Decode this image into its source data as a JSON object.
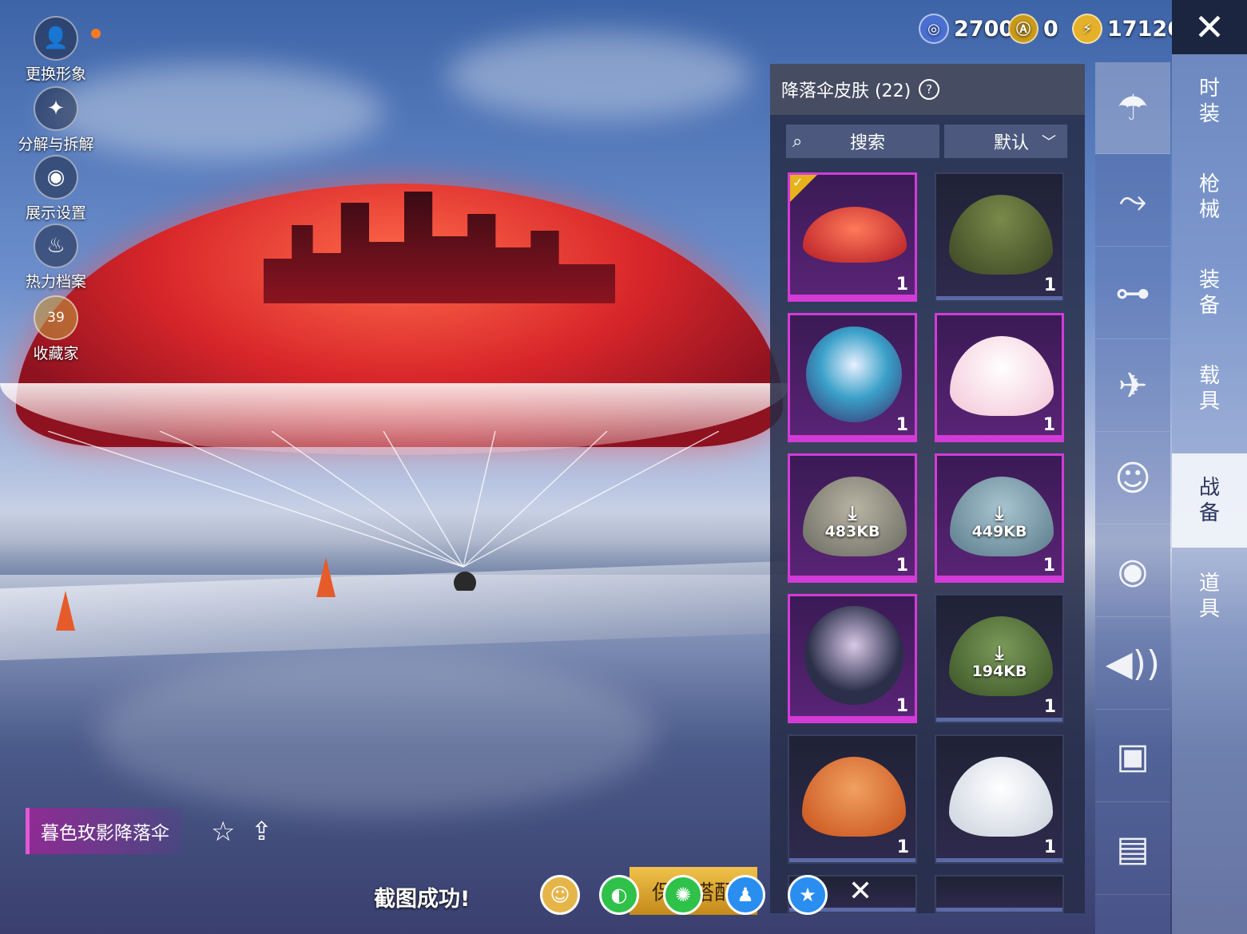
{
  "left_menu": [
    {
      "label": "更换形象",
      "icon": "avatar-icon"
    },
    {
      "label": "分解与拆解",
      "icon": "puzzle-icon"
    },
    {
      "label": "展示设置",
      "icon": "eye-icon"
    },
    {
      "label": "热力档案",
      "icon": "flame-icon"
    },
    {
      "label": "收藏家",
      "icon": "collector-badge-icon",
      "badge": "39"
    }
  ],
  "currencies": [
    {
      "value": "2700",
      "icon": "uc-coin-icon",
      "color": "#4a6fd0"
    },
    {
      "value": "0",
      "icon": "gold-ag-icon",
      "color": "#c99a1a"
    },
    {
      "value": "17126",
      "icon": "bp-lightning-icon",
      "color": "#e6b12a"
    }
  ],
  "close_glyph": "✕",
  "right_tabs": [
    {
      "label": [
        "时",
        "装"
      ]
    },
    {
      "label": [
        "枪",
        "械"
      ]
    },
    {
      "label": [
        "装",
        "备"
      ]
    },
    {
      "label": [
        "载",
        "具"
      ]
    },
    {
      "label": [
        "战",
        "备"
      ],
      "active": true
    },
    {
      "label": [
        "道",
        "具"
      ]
    }
  ],
  "icon_column": [
    {
      "icon": "parachute-icon",
      "glyph": "☂",
      "active": true
    },
    {
      "icon": "skydiving-icon",
      "glyph": "🪂"
    },
    {
      "icon": "drone-icon",
      "glyph": "✈"
    },
    {
      "icon": "airplane-icon",
      "glyph": "✈"
    },
    {
      "icon": "emote-icon",
      "glyph": "☺"
    },
    {
      "icon": "companion-icon",
      "glyph": "◉"
    },
    {
      "icon": "sound-icon",
      "glyph": "🔊"
    },
    {
      "icon": "chat-bubble-icon",
      "glyph": "▣"
    },
    {
      "icon": "gallery-icon",
      "glyph": "▤"
    }
  ],
  "panel": {
    "title": "降落伞皮肤 (22)",
    "help": "?",
    "search_placeholder": "搜索",
    "sort_label": "默认",
    "sort_chevron": "﹀"
  },
  "items": [
    {
      "count": "1",
      "rarity": "epic",
      "equipped": true,
      "color": "#d8262a"
    },
    {
      "count": "1",
      "rarity": "blue",
      "color": "#5a6a3a"
    },
    {
      "count": "1",
      "rarity": "epic",
      "color": "#3aa0c8"
    },
    {
      "count": "1",
      "rarity": "epic",
      "color": "#f3c4d6"
    },
    {
      "count": "1",
      "rarity": "epic",
      "download": "483KB",
      "color": "#8a8a84"
    },
    {
      "count": "1",
      "rarity": "epic",
      "download": "449KB",
      "color": "#7ea2b4"
    },
    {
      "count": "1",
      "rarity": "epic",
      "color": "#2b2f4a"
    },
    {
      "count": "1",
      "rarity": "blue",
      "download": "194KB",
      "color": "#4d6a34"
    },
    {
      "count": "1",
      "rarity": "blue",
      "color": "#e06a2a"
    },
    {
      "count": "1",
      "rarity": "blue",
      "color": "#e6e8ee"
    }
  ],
  "selected_name": "暮色玫影降落伞",
  "save_button": "保存搭配",
  "toast": "截图成功!",
  "share": [
    {
      "icon": "share-avatar-icon",
      "color": "#e6b54a"
    },
    {
      "icon": "wechat-icon",
      "color": "#2fc14a"
    },
    {
      "icon": "moments-icon",
      "color": "#2fc14a"
    },
    {
      "icon": "qq-icon",
      "color": "#2a8ef0"
    },
    {
      "icon": "qzone-icon",
      "color": "#2a8ef0"
    }
  ],
  "share_close": "✕"
}
